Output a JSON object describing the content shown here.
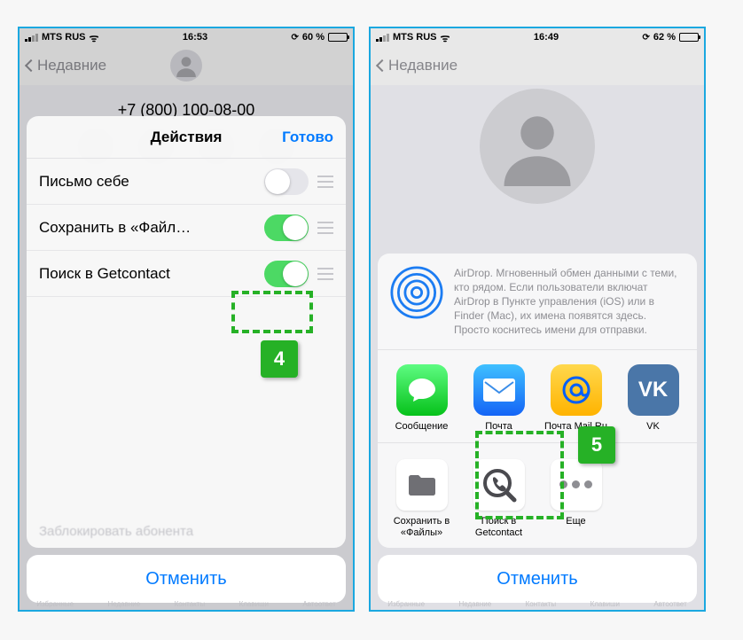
{
  "left": {
    "status": {
      "carrier": "MTS RUS",
      "time": "16:53",
      "battery": "60 %"
    },
    "nav_back": "Недавние",
    "phone_number": "+7 (800) 100-08-00",
    "sheet": {
      "title": "Действия",
      "done": "Готово",
      "rows": [
        {
          "label": "Письмо себе",
          "on": false
        },
        {
          "label": "Сохранить в «Файл…",
          "on": true
        },
        {
          "label": "Поиск в Getcontact",
          "on": true
        }
      ],
      "cancel": "Отменить"
    },
    "callout": "4",
    "faded_footer": "Заблокировать абонента"
  },
  "right": {
    "status": {
      "carrier": "MTS RUS",
      "time": "16:49",
      "battery": "62 %"
    },
    "nav_back": "Недавние",
    "airdrop_text": "AirDrop. Мгновенный обмен данными с теми, кто рядом. Если пользователи включат AirDrop в Пункте управления (iOS) или в Finder (Mac), их имена появятся здесь. Просто коснитесь имени для отправки.",
    "apps": [
      {
        "label": "Сообщение"
      },
      {
        "label": "Почта"
      },
      {
        "label": "Почта Mail.Ru"
      },
      {
        "label": "VK"
      }
    ],
    "actions": [
      {
        "label": "Сохранить в «Файлы»"
      },
      {
        "label": "Поиск в Getcontact"
      },
      {
        "label": "Еще"
      }
    ],
    "cancel": "Отменить",
    "callout": "5"
  },
  "tabbar": [
    "Избранные",
    "Недавние",
    "Контакты",
    "Клавиши",
    "Автоответ"
  ]
}
